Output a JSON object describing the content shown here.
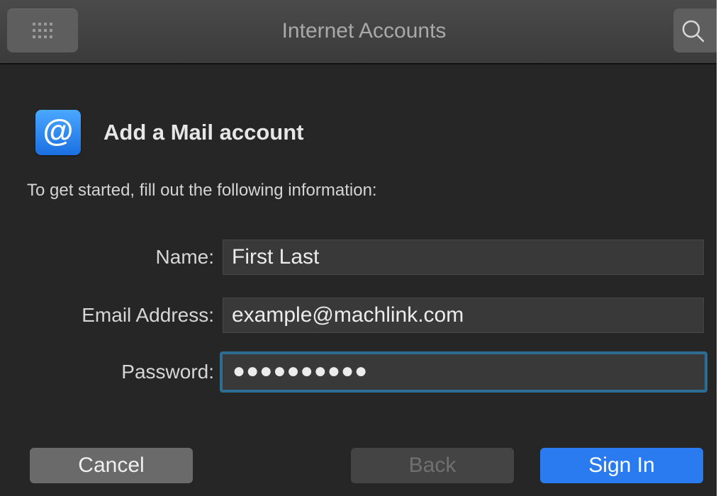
{
  "window": {
    "title": "Internet Accounts"
  },
  "toolbar": {
    "grid_icon": "grid-icon",
    "search_icon": "search-icon"
  },
  "header": {
    "icon": "at-sign-icon",
    "icon_glyph": "@",
    "title": "Add a Mail account"
  },
  "intro": "To get started, fill out the following information:",
  "form": {
    "name": {
      "label": "Name:",
      "value": "First Last"
    },
    "email": {
      "label": "Email Address:",
      "value": "example@machlink.com"
    },
    "password": {
      "label": "Password:",
      "value": "●●●●●●●●●●"
    }
  },
  "buttons": {
    "cancel": "Cancel",
    "back": "Back",
    "sign_in": "Sign In"
  },
  "colors": {
    "accent": "#2a7bf0",
    "focus_ring": "#2e6d93",
    "background": "#262626"
  }
}
